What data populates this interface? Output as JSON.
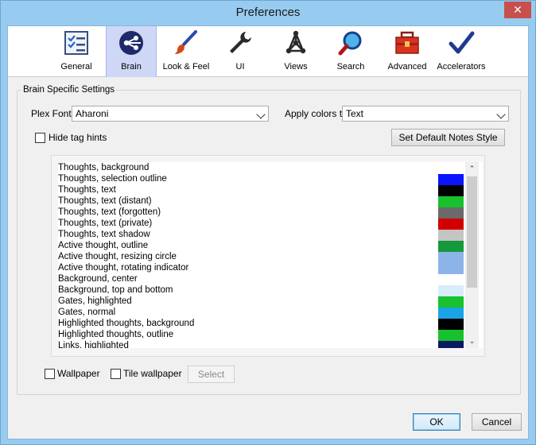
{
  "window": {
    "title": "Preferences",
    "close_glyph": "✕"
  },
  "toolbar": {
    "items": [
      {
        "label": "General",
        "icon": "checklist-icon"
      },
      {
        "label": "Brain",
        "icon": "brain-icon"
      },
      {
        "label": "Look & Feel",
        "icon": "paintbrush-icon"
      },
      {
        "label": "UI",
        "icon": "wrench-icon"
      },
      {
        "label": "Views",
        "icon": "network-icon"
      },
      {
        "label": "Search",
        "icon": "magnifier-icon"
      },
      {
        "label": "Advanced",
        "icon": "toolbox-icon"
      },
      {
        "label": "Accelerators",
        "icon": "checkmark-icon"
      }
    ],
    "active": "Brain"
  },
  "settings": {
    "group_title": "Brain Specific Settings",
    "plex_font_label": "Plex Font",
    "plex_font_value": "Aharoni",
    "apply_colors_label": "Apply colors to",
    "apply_colors_value": "Text",
    "hide_tag_hints_label": "Hide tag hints",
    "set_default_notes_style_label": "Set Default Notes Style"
  },
  "colors_list": [
    {
      "name": "Thoughts, background",
      "color": "#ffffff"
    },
    {
      "name": "Thoughts, selection outline",
      "color": "#0a14ff"
    },
    {
      "name": "Thoughts, text",
      "color": "#000000"
    },
    {
      "name": "Thoughts, text (distant)",
      "color": "#17c22e"
    },
    {
      "name": "Thoughts, text (forgotten)",
      "color": "#6a6a6a"
    },
    {
      "name": "Thoughts, text (private)",
      "color": "#d10000"
    },
    {
      "name": "Thoughts, text shadow",
      "color": "#c4c4c4"
    },
    {
      "name": "Active thought, outline",
      "color": "#149a3a"
    },
    {
      "name": "Active thought, resizing circle",
      "color": "#8cb4e8"
    },
    {
      "name": "Active thought, rotating indicator",
      "color": "#8cb4e8"
    },
    {
      "name": "Background, center",
      "color": "#ffffff"
    },
    {
      "name": "Background, top and bottom",
      "color": "#d8ecfa"
    },
    {
      "name": "Gates, highlighted",
      "color": "#17c22e"
    },
    {
      "name": "Gates, normal",
      "color": "#1aa3e6"
    },
    {
      "name": "Highlighted thoughts, background",
      "color": "#000000"
    },
    {
      "name": "Highlighted thoughts, outline",
      "color": "#17c22e"
    },
    {
      "name": "Links, highlighted",
      "color": "#0c1860"
    }
  ],
  "wallpaper": {
    "wallpaper_label": "Wallpaper",
    "tile_wallpaper_label": "Tile wallpaper",
    "select_label": "Select"
  },
  "footer": {
    "ok_label": "OK",
    "cancel_label": "Cancel"
  },
  "scroll": {
    "up_glyph": "⌃",
    "down_glyph": "⌄"
  }
}
